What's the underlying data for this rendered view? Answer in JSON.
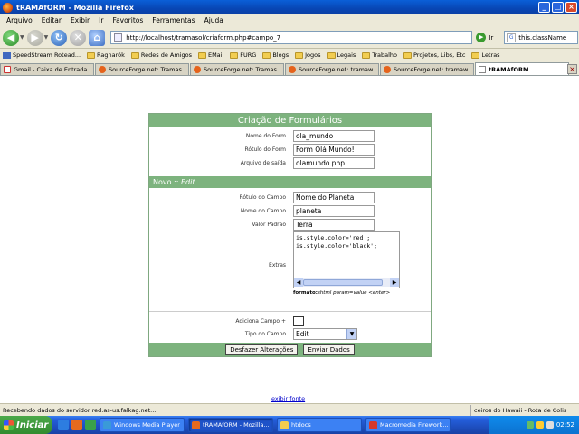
{
  "window": {
    "title": "tRAMAfORM - Mozilla Firefox",
    "controls": [
      "_",
      "□",
      "×"
    ]
  },
  "menu": [
    "Arquivo",
    "Editar",
    "Exibir",
    "Ir",
    "Favoritos",
    "Ferramentas",
    "Ajuda"
  ],
  "nav": {
    "url": "http://localhost/tramasol/criaform.php#campo_7",
    "go_label": "Ir",
    "search_value": "this.className"
  },
  "bookmarks": [
    {
      "label": "SpeedStream Rotead...",
      "icon": "speedstream-icon"
    },
    {
      "label": "Ragnarök",
      "icon": "folder-icon"
    },
    {
      "label": "Redes de Amigos",
      "icon": "folder-icon"
    },
    {
      "label": "EMail",
      "icon": "folder-icon"
    },
    {
      "label": "FURG",
      "icon": "folder-icon"
    },
    {
      "label": "Blogs",
      "icon": "folder-icon"
    },
    {
      "label": "Jogos",
      "icon": "folder-icon"
    },
    {
      "label": "Legais",
      "icon": "folder-icon"
    },
    {
      "label": "Trabalho",
      "icon": "folder-icon"
    },
    {
      "label": "Projetos, Libs, Etc",
      "icon": "folder-icon"
    },
    {
      "label": "Letras",
      "icon": "folder-icon"
    }
  ],
  "tabs": [
    {
      "label": "Gmail - Caixa de Entrada"
    },
    {
      "label": "SourceForge.net: Tramas..."
    },
    {
      "label": "SourceForge.net: Tramas..."
    },
    {
      "label": "SourceForge.net: tramaw..."
    },
    {
      "label": "SourceForge.net: tramaw..."
    },
    {
      "label": "tRAMAfORM"
    }
  ],
  "form": {
    "title": "Criação de Formulários",
    "fields": [
      {
        "label": "Nome do Form",
        "value": "ola_mundo"
      },
      {
        "label": "Rótulo do Form",
        "value": "Form Olá Mundo!"
      },
      {
        "label": "Arquivo de saída",
        "value": "olamundo.php"
      }
    ],
    "section_prefix": "Novo :: ",
    "section_mode": "Edit",
    "campo_fields": [
      {
        "label": "Rótulo do Campo",
        "value": "Nome do Planeta"
      },
      {
        "label": "Nome do Campo",
        "value": "planeta"
      },
      {
        "label": "Valor Padrao",
        "value": "Terra"
      }
    ],
    "extras_label": "Extras",
    "extras_value": "is.style.color='red';\nis.style.color='black';",
    "hint_bold": "formato:",
    "hint_italic": "shtml param=value <enter>",
    "add_field_label": "Adiciona Campo +",
    "field_type_label": "Tipo do Campo",
    "field_type_value": "Edit",
    "undo_button": "Desfazer Alterações",
    "submit_button": "Enviar Dados"
  },
  "footer_link": "exibir fonte",
  "status": {
    "text": "Recebendo dados do servidor red.as-us.falkag.net...",
    "panel": "ceiros do Hawaii - Rota de Colis"
  },
  "taskbar": {
    "start": "Iniciar",
    "tasks": [
      {
        "label": "Windows Media Player",
        "active": false
      },
      {
        "label": "tRAMAfORM - Mozilla...",
        "active": true
      },
      {
        "label": "htdocs",
        "active": false
      },
      {
        "label": "Macromedia Firework...",
        "active": false
      }
    ],
    "clock": "02:52"
  },
  "colors": {
    "form_green": "#7db37e",
    "xp_blue": "#245edb",
    "start_green": "#328b2f"
  }
}
